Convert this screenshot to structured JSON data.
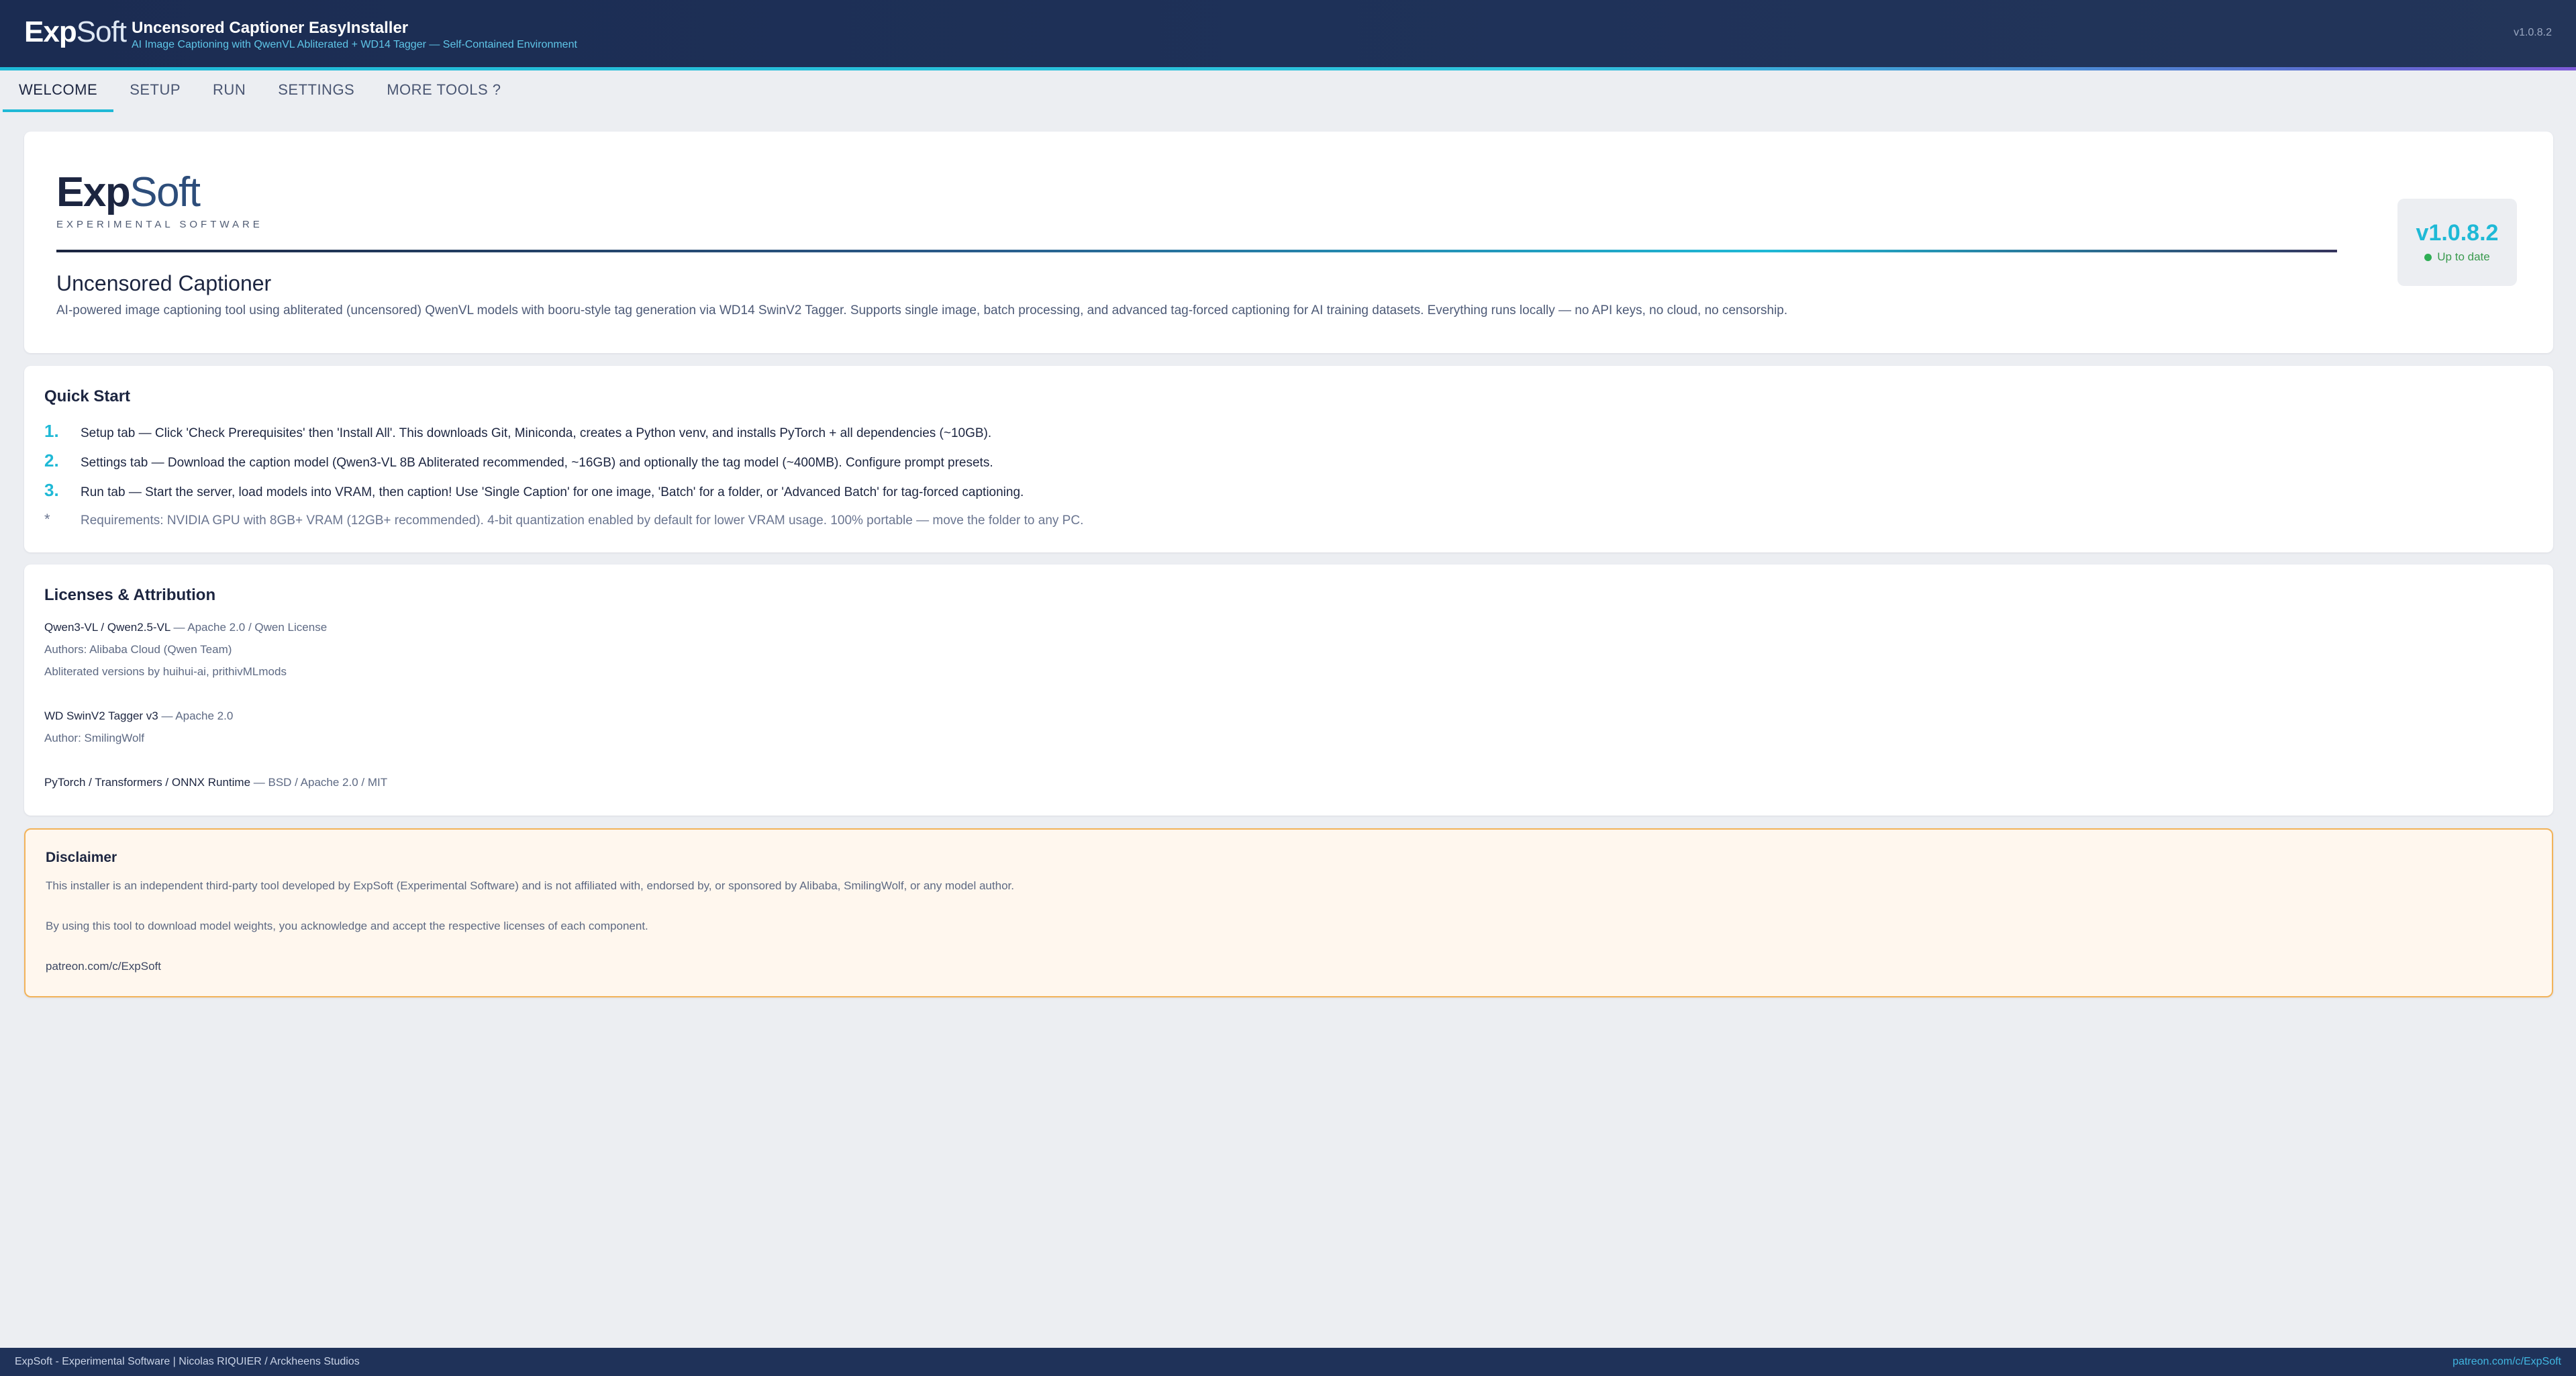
{
  "header": {
    "logo_bold": "Exp",
    "logo_light": "Soft",
    "title": "Uncensored Captioner EasyInstaller",
    "subtitle": "AI Image Captioning with QwenVL Abliterated + WD14 Tagger — Self-Contained Environment",
    "version": "v1.0.8.2"
  },
  "tabs": [
    {
      "label": "WELCOME",
      "active": true
    },
    {
      "label": "SETUP"
    },
    {
      "label": "RUN"
    },
    {
      "label": "SETTINGS"
    },
    {
      "label": "MORE TOOLS ?"
    }
  ],
  "hero": {
    "brand_bold": "Exp",
    "brand_light": "Soft",
    "brand_tagline": "EXPERIMENTAL SOFTWARE",
    "app_title": "Uncensored Captioner",
    "description": "AI-powered image captioning tool using abliterated (uncensored) QwenVL models with booru-style tag generation via WD14 SwinV2 Tagger. Supports single image, batch processing, and advanced tag-forced captioning for AI training datasets. Everything runs locally — no API keys, no cloud, no censorship.",
    "version": "v1.0.8.2",
    "status": "Up to date",
    "status_color": "#2fae55"
  },
  "quick_start": {
    "title": "Quick Start",
    "steps": [
      {
        "num": "1.",
        "text": "Setup tab — Click 'Check Prerequisites' then 'Install All'. This downloads Git, Miniconda, creates a Python venv, and installs PyTorch + all dependencies (~10GB)."
      },
      {
        "num": "2.",
        "text": "Settings tab — Download the caption model (Qwen3-VL 8B Abliterated recommended, ~16GB) and optionally the tag model (~400MB). Configure prompt presets."
      },
      {
        "num": "3.",
        "text": "Run tab — Start the server, load models into VRAM, then caption! Use 'Single Caption' for one image, 'Batch' for a folder, or 'Advanced Batch' for tag-forced captioning."
      }
    ],
    "note_marker": "*",
    "note": "Requirements: NVIDIA GPU with 8GB+ VRAM (12GB+ recommended). 4-bit quantization enabled by default for lower VRAM usage. 100% portable — move the folder to any PC."
  },
  "licenses": {
    "title": "Licenses & Attribution",
    "qwen_name": "Qwen3-VL / Qwen2.5-VL",
    "qwen_license": " — Apache 2.0 / Qwen License",
    "qwen_authors": "Authors: Alibaba Cloud (Qwen Team)",
    "qwen_abliterated": "Abliterated versions by huihui-ai, prithivMLmods",
    "wd_name": "WD SwinV2 Tagger v3",
    "wd_license": " — Apache 2.0",
    "wd_author": "Author: SmilingWolf",
    "pt_name": "PyTorch / Transformers / ONNX Runtime",
    "pt_license": " — BSD / Apache 2.0 / MIT"
  },
  "disclaimer": {
    "title": "Disclaimer",
    "line1": "This installer is an independent third-party tool developed by ExpSoft (Experimental Software) and is not affiliated with, endorsed by, or sponsored by Alibaba, SmilingWolf, or any model author.",
    "line2": "By using this tool to download model weights, you acknowledge and accept the respective licenses of each component.",
    "link": "patreon.com/c/ExpSoft"
  },
  "footer": {
    "left": "ExpSoft - Experimental Software |  Nicolas RIQUIER / Arckheens Studios",
    "right": "patreon.com/c/ExpSoft"
  }
}
